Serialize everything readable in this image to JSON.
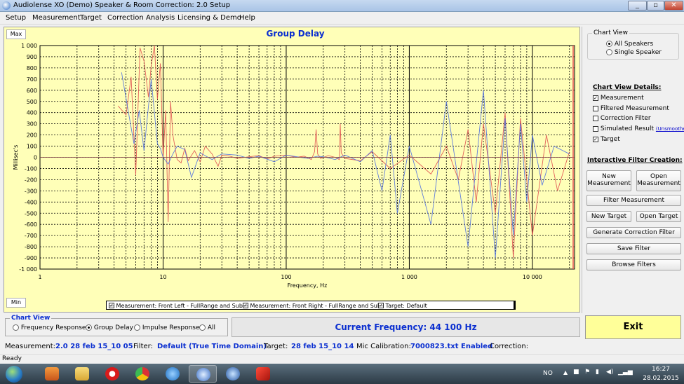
{
  "window": {
    "title": "Audiolense XO (Demo) Speaker & Room Correction: 2.0 Setup",
    "controls": {
      "minimize": "_",
      "maximize": "▫",
      "close": "✕"
    }
  },
  "menu": [
    "Setup",
    "Measurement",
    "Target",
    "Correction",
    "Analysis",
    "Licensing & Demo",
    "Help"
  ],
  "chart": {
    "max_label": "Max",
    "min_label": "Min"
  },
  "chart_data": {
    "type": "line",
    "title": "Group Delay",
    "xlabel": "Frequency, Hz",
    "ylabel": "Millisec's",
    "xscale": "log",
    "xlim": [
      1,
      22000
    ],
    "ylim": [
      -1000,
      1000
    ],
    "x_tick_labels": [
      "1",
      "10",
      "100",
      "1 000",
      "10 000"
    ],
    "y_tick_labels": [
      "1 000",
      "900",
      "800",
      "700",
      "600",
      "500",
      "400",
      "300",
      "200",
      "100",
      "0",
      "-100",
      "-200",
      "-300",
      "-400",
      "-500",
      "-600",
      "-700",
      "-800",
      "-900",
      "-1 000"
    ],
    "grid": true,
    "series": [
      {
        "name": "Measurement: Front Left - FullRange and Sub",
        "color": "#e05050",
        "x": [
          4.3,
          5.0,
          5.5,
          6.0,
          6.5,
          7.0,
          7.6,
          8.0,
          8.5,
          9.0,
          9.5,
          10.0,
          10.5,
          11.0,
          11.5,
          12.0,
          13.0,
          14.0,
          15.0,
          16.0,
          18.0,
          20.0,
          22.0,
          25.0,
          28.0,
          30.0,
          35.0,
          40.0,
          50.0,
          60.0,
          70.0,
          80.0,
          100.0,
          120.0,
          140.0,
          160.0,
          170.0,
          175.0,
          180.0,
          190.0,
          220.0,
          250.0,
          270.0,
          275.0,
          280.0,
          300.0,
          400.0,
          500.0,
          700.0,
          1000.0,
          1500.0,
          2000.0,
          2500.0,
          3000.0,
          3500.0,
          4000.0,
          5000.0,
          6000.0,
          7000.0,
          8000.0,
          10000.0,
          13000.0,
          16000.0,
          20000.0
        ],
        "y": [
          460,
          380,
          720,
          -160,
          980,
          860,
          540,
          820,
          1000,
          520,
          840,
          0,
          420,
          -580,
          500,
          200,
          -20,
          -50,
          80,
          -30,
          60,
          -40,
          100,
          30,
          -80,
          20,
          10,
          -10,
          5,
          15,
          -15,
          10,
          20,
          0,
          10,
          -20,
          50,
          250,
          30,
          -10,
          15,
          0,
          -20,
          300,
          40,
          -10,
          -30,
          50,
          -100,
          20,
          -150,
          100,
          -200,
          250,
          -400,
          300,
          -500,
          400,
          -900,
          350,
          -700,
          200,
          -300,
          50
        ]
      },
      {
        "name": "Measurement: Front Right - FullRange and Sub",
        "color": "#5070e0",
        "x": [
          4.6,
          5.2,
          5.8,
          6.4,
          7.0,
          8.0,
          9.0,
          9.5,
          10.0,
          11.0,
          12.0,
          13.0,
          15.0,
          17.0,
          20.0,
          25.0,
          30.0,
          40.0,
          50.0,
          60.0,
          80.0,
          100.0,
          130.0,
          150.0,
          180.0,
          200.0,
          250.0,
          300.0,
          400.0,
          500.0,
          600.0,
          700.0,
          800.0,
          1000.0,
          1500.0,
          2000.0,
          3000.0,
          4000.0,
          5000.0,
          6000.0,
          7000.0,
          8000.0,
          9000.0,
          10000.0,
          12000.0,
          15000.0,
          20000.0
        ],
        "y": [
          760,
          420,
          120,
          420,
          60,
          700,
          120,
          80,
          0,
          -60,
          30,
          100,
          70,
          -180,
          40,
          -20,
          30,
          20,
          -10,
          10,
          -40,
          20,
          0,
          -10,
          10,
          5,
          -20,
          20,
          -40,
          60,
          -300,
          200,
          -500,
          100,
          -600,
          500,
          -800,
          600,
          -900,
          350,
          -700,
          300,
          -400,
          200,
          -250,
          100,
          30
        ]
      },
      {
        "name": "Target: Default",
        "color": "#8a5050",
        "x": [
          1,
          10,
          100,
          1000,
          10000,
          22000
        ],
        "y": [
          0,
          0,
          0,
          0,
          0,
          0
        ]
      }
    ],
    "legend_position": "bottom"
  },
  "legend": {
    "items": [
      {
        "checked": "✓",
        "label": "— Measurement: Front Left - FullRange and Sub"
      },
      {
        "checked": "✓",
        "label": "— Measurement: Front Right - FullRange and Sub"
      },
      {
        "checked": "✓",
        "label": "— Target: Default"
      }
    ]
  },
  "right_panel": {
    "chart_view_title": "Chart View",
    "all_speakers": "All Speakers",
    "single_speaker": "Single Speaker",
    "details_heading": "Chart View Details:",
    "details": [
      "Measurement",
      "Filtered Measurement",
      "Correction Filter",
      "Simulated Result",
      "Target"
    ],
    "details_checked": [
      "✓",
      "",
      "",
      "",
      "✓"
    ],
    "unsmoothed": "(Unsmoothed)",
    "interactive_heading": "Interactive Filter Creation:",
    "new_measurement": [
      "New",
      "Measurement"
    ],
    "open_measurement": [
      "Open",
      "Measurement"
    ],
    "filter_measurement": "Filter Measurement",
    "new_target": "New Target",
    "open_target": "Open Target",
    "generate_filter": "Generate Correction Filter",
    "save_filter": "Save Filter",
    "browse_filters": "Browse Filters"
  },
  "bottom": {
    "chart_view_label": "Chart View",
    "options": [
      "Frequency Response",
      "Group Delay",
      "Impulse Response",
      "All"
    ],
    "selected_option": "Group Delay",
    "current_frequency": "Current Frequency: 44 100 Hz",
    "exit": "Exit"
  },
  "info": {
    "measurement_label": "Measurement:",
    "measurement_value": "2.0 28 feb 15_10 05",
    "filter_label": "Filter:",
    "filter_value": "Default (True Time Domain)",
    "target_label": "Target:",
    "target_value": "28 feb 15_10 14",
    "mic_label": "Mic Calibration:",
    "mic_value": "7000823.txt Enabled",
    "correction_label": "Correction:"
  },
  "status": "Ready",
  "taskbar": {
    "lang": "NO",
    "time": "16:27",
    "date": "28.02.2015"
  }
}
